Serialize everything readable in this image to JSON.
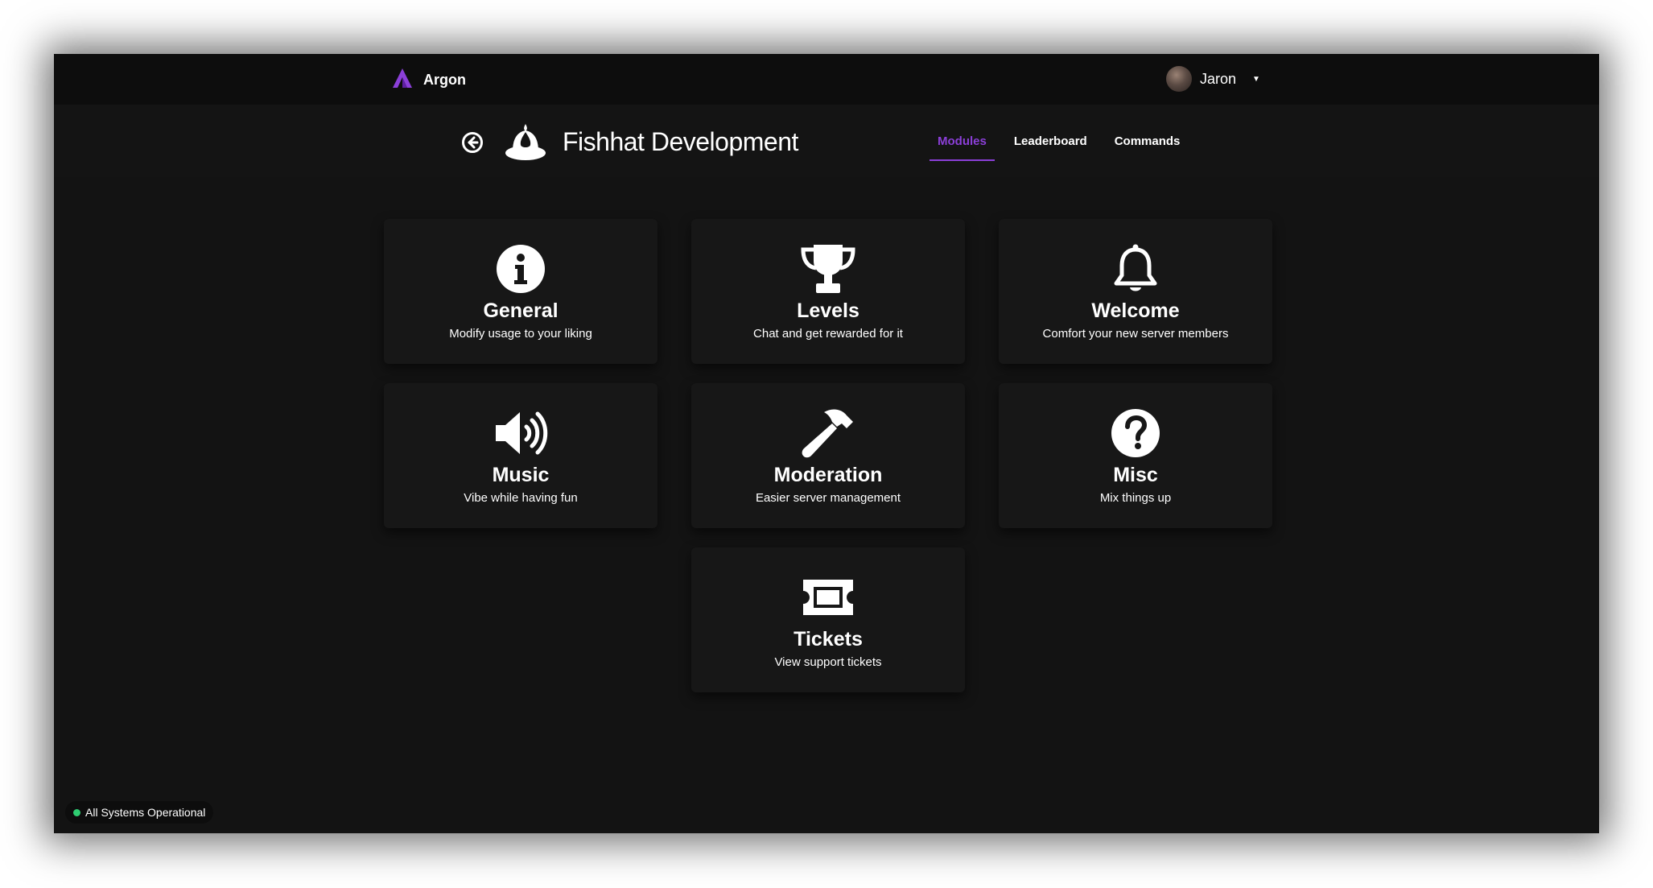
{
  "brand": {
    "name": "Argon",
    "accent": "#8b3fd8"
  },
  "user": {
    "name": "Jaron",
    "caret": "▼"
  },
  "server": {
    "name": "Fishhat Development"
  },
  "tabs": [
    {
      "label": "Modules",
      "active": true
    },
    {
      "label": "Leaderboard",
      "active": false
    },
    {
      "label": "Commands",
      "active": false
    }
  ],
  "modules": [
    {
      "title": "General",
      "description": "Modify usage to your liking",
      "icon": "info-circle-icon"
    },
    {
      "title": "Levels",
      "description": "Chat and get rewarded for it",
      "icon": "trophy-icon"
    },
    {
      "title": "Welcome",
      "description": "Comfort your new server members",
      "icon": "bell-icon"
    },
    {
      "title": "Music",
      "description": "Vibe while having fun",
      "icon": "speaker-icon"
    },
    {
      "title": "Moderation",
      "description": "Easier server management",
      "icon": "hammer-icon"
    },
    {
      "title": "Misc",
      "description": "Mix things up",
      "icon": "question-circle-icon"
    },
    {
      "title": "Tickets",
      "description": "View support tickets",
      "icon": "ticket-icon"
    }
  ],
  "status": {
    "text": "All Systems Operational",
    "color": "#2ecc71"
  }
}
